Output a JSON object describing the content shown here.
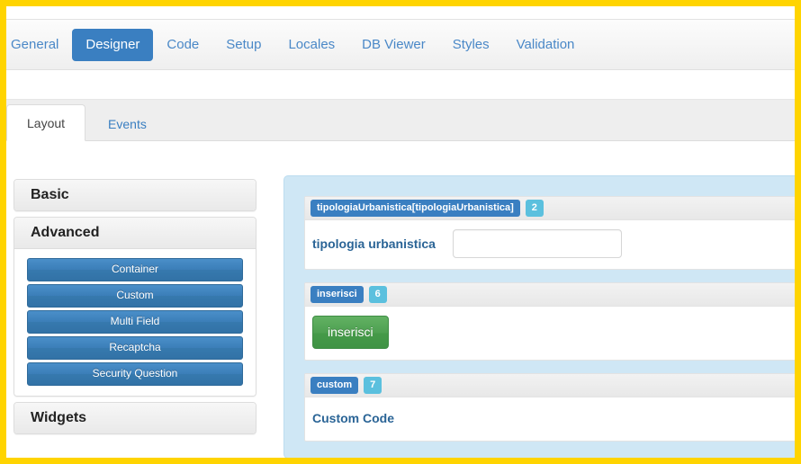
{
  "theme": {
    "highlight_border_color": "#ffd400",
    "primary_blue": "#3a7fc1",
    "link_blue": "#4a88c7",
    "badge_cyan": "#5bc0de",
    "submit_green": "#4ea051",
    "canvas_blue": "#cfe7f5",
    "label_blue": "#2a6496"
  },
  "navbar": {
    "items": [
      {
        "label": "General",
        "active": false
      },
      {
        "label": "Designer",
        "active": true
      },
      {
        "label": "Code",
        "active": false
      },
      {
        "label": "Setup",
        "active": false
      },
      {
        "label": "Locales",
        "active": false
      },
      {
        "label": "DB Viewer",
        "active": false
      },
      {
        "label": "Styles",
        "active": false
      },
      {
        "label": "Validation",
        "active": false
      }
    ]
  },
  "subtabs": {
    "items": [
      {
        "label": "Layout",
        "active": true
      },
      {
        "label": "Events",
        "active": false
      }
    ]
  },
  "sidebar": {
    "panels": [
      {
        "title": "Basic",
        "expanded": false,
        "buttons": []
      },
      {
        "title": "Advanced",
        "expanded": true,
        "buttons": [
          "Container",
          "Custom",
          "Multi Field",
          "Recaptcha",
          "Security Question"
        ]
      },
      {
        "title": "Widgets",
        "expanded": false,
        "buttons": []
      }
    ]
  },
  "designer": {
    "rows": [
      {
        "tag": "tipologiaUrbanistica[tipologiaUrbanistica]",
        "badge": "2",
        "kind": "text-field",
        "label": "tipologia urbanistica",
        "input_value": "",
        "input_placeholder": ""
      },
      {
        "tag": "inserisci",
        "badge": "6",
        "kind": "submit-button",
        "button_label": "inserisci"
      },
      {
        "tag": "custom",
        "badge": "7",
        "kind": "custom-code",
        "text": "Custom Code"
      }
    ]
  }
}
